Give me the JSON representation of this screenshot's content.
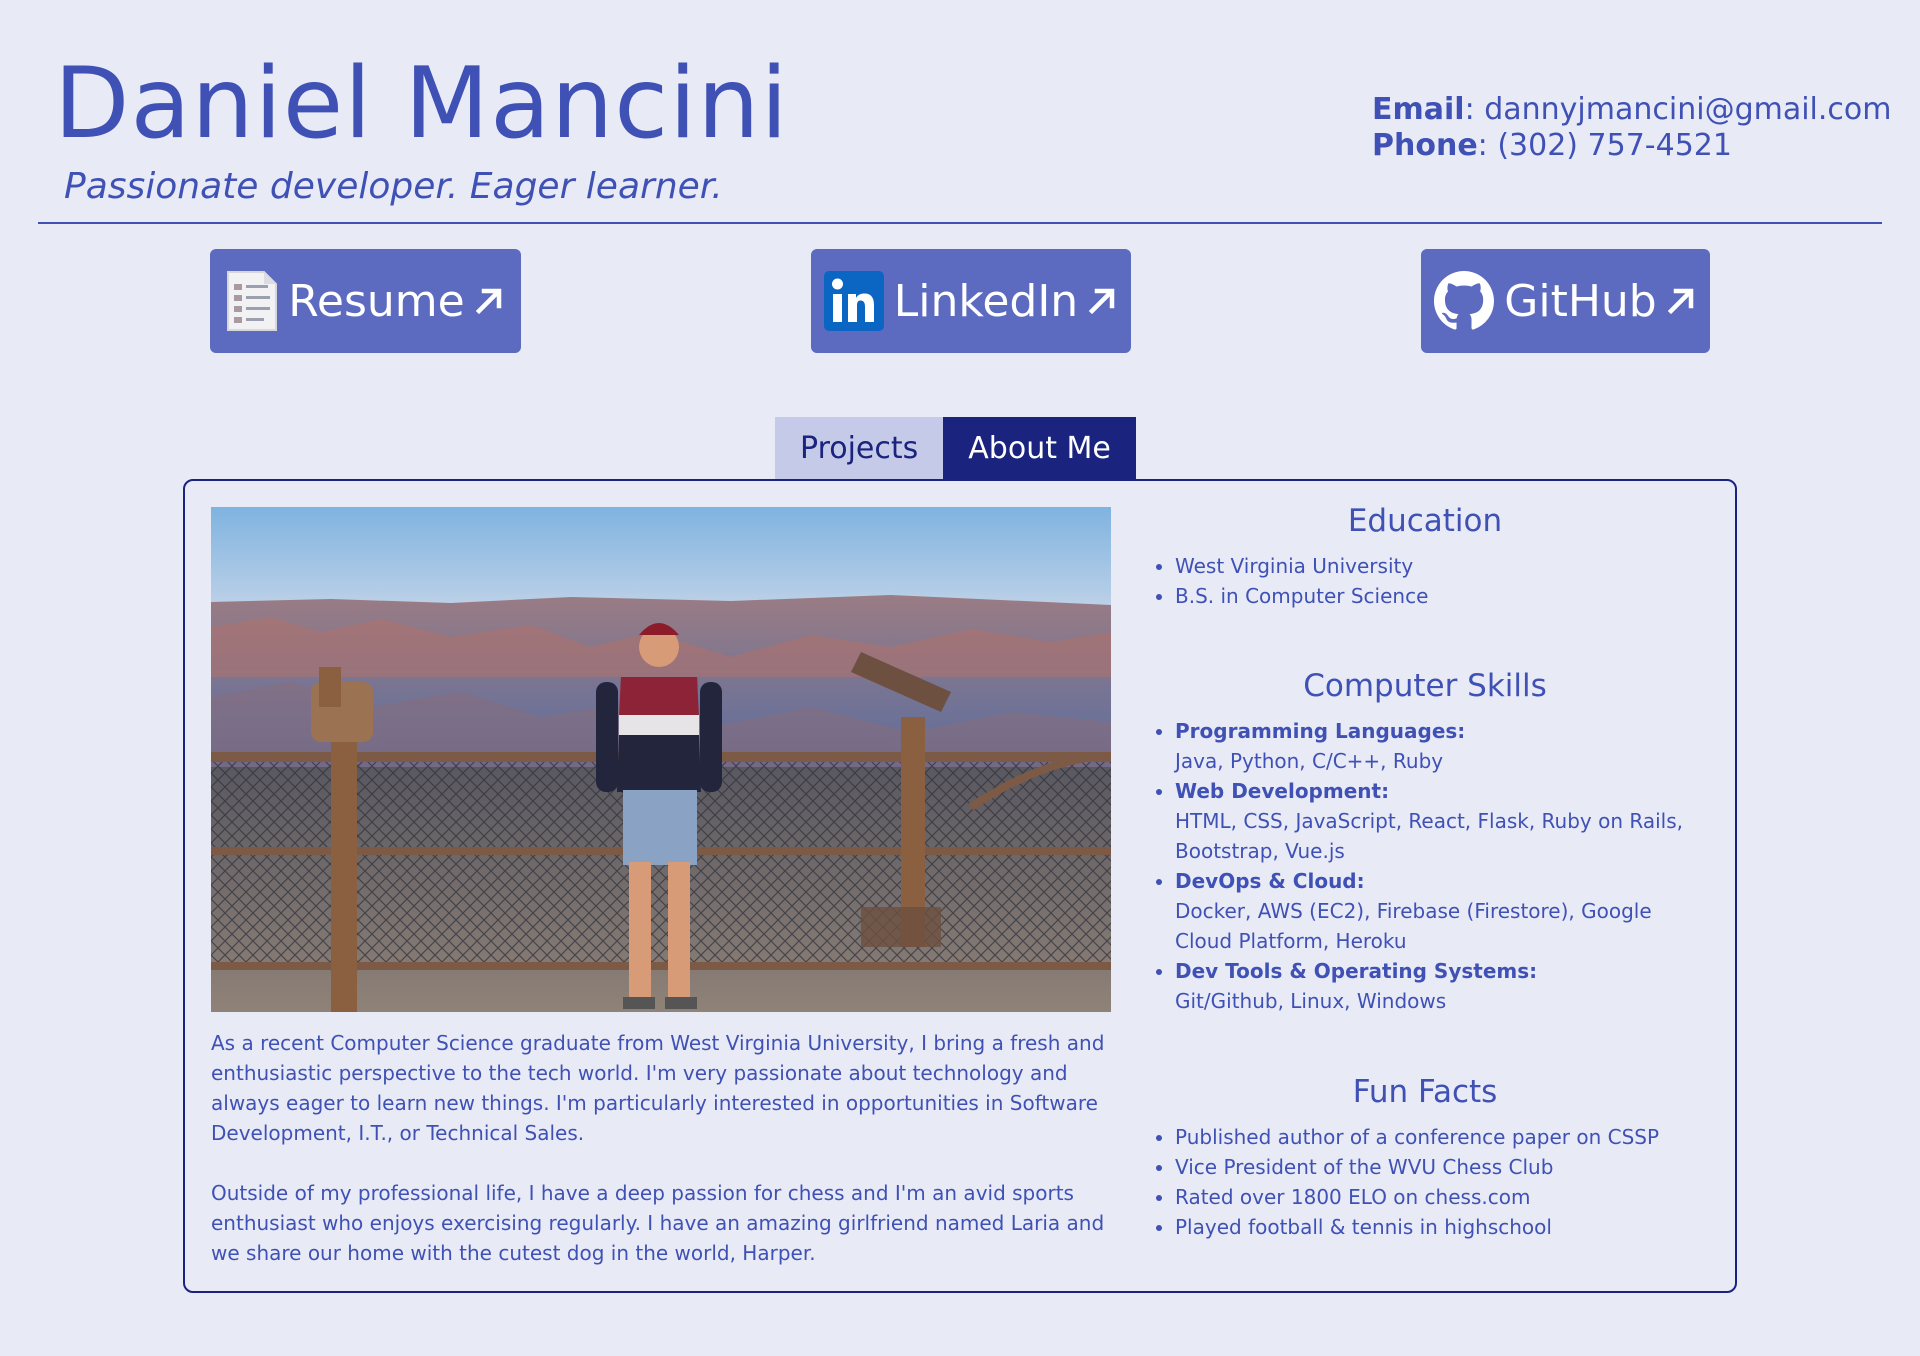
{
  "header": {
    "name": "Daniel Mancini",
    "tagline": "Passionate developer. Eager learner.",
    "email_label": "Email",
    "email_value": ": dannyjmancini@gmail.com",
    "phone_label": "Phone",
    "phone_value": ": (302) 757-4521"
  },
  "links": {
    "resume": "Resume",
    "linkedin": "LinkedIn",
    "github": "GitHub"
  },
  "tabs": {
    "projects": "Projects",
    "about": "About Me",
    "active": "About Me"
  },
  "about": {
    "photo_icon": "photo-grand-canyon",
    "bio_1": "As a recent Computer Science graduate from West Virginia University, I bring a fresh and enthusiastic perspective to the tech world. I'm very passionate about technology and always eager to learn new things. I'm particularly interested in opportunities in Software Development, I.T., or Technical Sales.",
    "bio_2": "Outside of my professional life, I have a deep passion for chess and I'm an avid sports enthusiast who enjoys exercising regularly. I have an amazing girlfriend named Laria and we share our home with the cutest dog in the world, Harper."
  },
  "education": {
    "title": "Education",
    "items": [
      "West Virginia University",
      "B.S. in Computer Science"
    ]
  },
  "skills": {
    "title": "Computer Skills",
    "items": [
      {
        "label": "Programming Languages:",
        "value": "Java, Python, C/C++, Ruby"
      },
      {
        "label": "Web Development:",
        "value": "HTML, CSS, JavaScript, React, Flask, Ruby on Rails, Bootstrap, Vue.js"
      },
      {
        "label": "DevOps & Cloud:",
        "value": "Docker, AWS (EC2), Firebase (Firestore), Google Cloud Platform, Heroku"
      },
      {
        "label": "Dev Tools & Operating Systems:",
        "value": "Git/Github, Linux, Windows"
      }
    ]
  },
  "fun_facts": {
    "title": "Fun Facts",
    "items": [
      "Published author of a conference paper on CSSP",
      "Vice President of the WVU Chess Club",
      "Rated over 1800 ELO on chess.com",
      "Played football & tennis in highschool"
    ]
  },
  "colors": {
    "background": "#e8eaf6",
    "primary": "#3f51b5",
    "button": "#5c6bc0",
    "dark": "#1a237e",
    "tab_inactive": "#c5cae9"
  }
}
